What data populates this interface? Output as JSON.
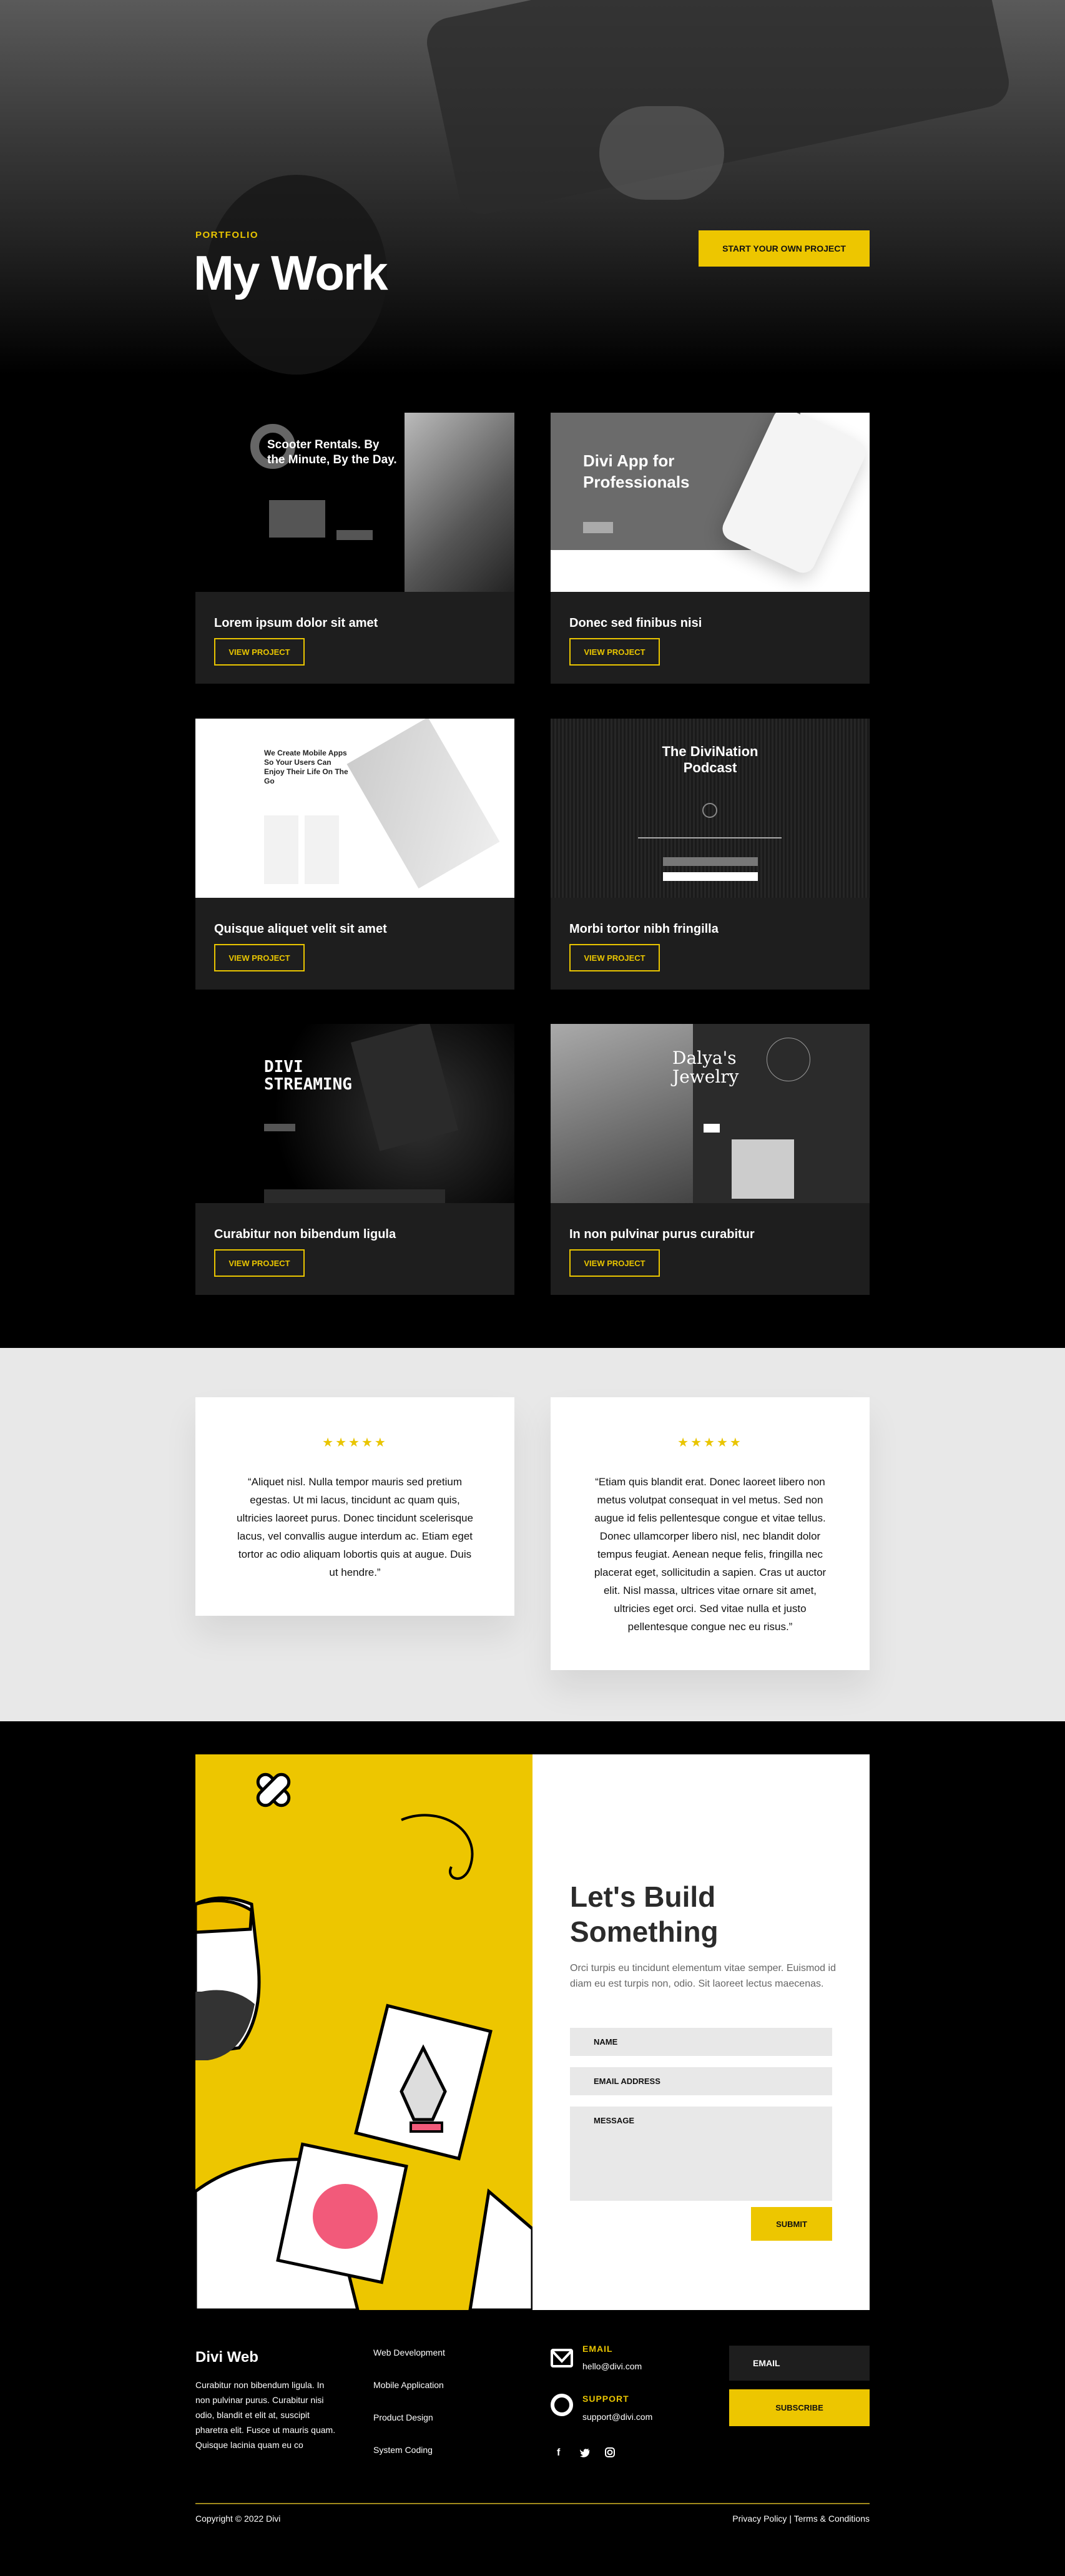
{
  "hero": {
    "eyebrow": "PORTFOLIO",
    "title": "My Work",
    "cta_label": "START YOUR OWN PROJECT"
  },
  "projects": [
    {
      "title": "Lorem ipsum dolor sit amet",
      "button": "VIEW PROJECT",
      "preview_heading": "Scooter Rentals. By the Minute, By the Day."
    },
    {
      "title": "Donec sed finibus nisi",
      "button": "VIEW PROJECT",
      "preview_heading": "Divi App for Professionals"
    },
    {
      "title": "Quisque aliquet velit sit amet",
      "button": "VIEW PROJECT",
      "preview_heading": "We Create Mobile Apps So Your Users Can Enjoy Their Life On The Go"
    },
    {
      "title": "Morbi tortor nibh fringilla",
      "button": "VIEW PROJECT",
      "preview_heading": "The DiviNation Podcast"
    },
    {
      "title": "Curabitur non bibendum ligula",
      "button": "VIEW PROJECT",
      "preview_heading": "DIVI STREAMING"
    },
    {
      "title": "In non pulvinar purus curabitur",
      "button": "VIEW PROJECT",
      "preview_heading": "Dalya's Jewelry"
    }
  ],
  "testimonials": [
    {
      "stars": "★★★★★",
      "rating": 5,
      "quote": "“Aliquet nisl. Nulla tempor mauris sed pretium egestas. Ut mi lacus, tincidunt ac quam quis, ultricies laoreet purus. Donec tincidunt scelerisque lacus, vel convallis augue interdum ac. Etiam eget tortor ac odio aliquam lobortis quis at augue. Duis ut hendre.”"
    },
    {
      "stars": "★★★★★",
      "rating": 5,
      "quote": "“Etiam quis blandit erat. Donec laoreet libero non metus volutpat consequat in vel metus. Sed non augue id felis pellentesque congue et vitae tellus. Donec ullamcorper libero nisl, nec blandit dolor tempus feugiat. Aenean neque felis, fringilla nec placerat eget, sollicitudin a sapien. Cras ut auctor elit. Nisl massa, ultrices vitae ornare sit amet, ultricies eget orci. Sed vitae nulla et justo pellentesque congue nec eu risus.”"
    }
  ],
  "contact": {
    "title": "Let's Build Something",
    "text": "Orci turpis eu tincidunt elementum vitae semper. Euismod id diam eu est turpis non, odio. Sit laoreet lectus maecenas.",
    "name_placeholder": "NAME",
    "email_placeholder": "EMAIL ADDRESS",
    "message_placeholder": "MESSAGE",
    "submit": "SUBMIT"
  },
  "footer": {
    "brand": "Divi Web",
    "about": "Curabitur non bibendum ligula. In non pulvinar purus. Curabitur nisi odio, blandit et elit at, suscipit pharetra elit. Fusce ut mauris quam. Quisque lacinia quam eu co",
    "links": [
      "Web Development",
      "Mobile Application",
      "Product Design",
      "System Coding"
    ],
    "email_label": "EMAIL",
    "email": "hello@divi.com",
    "support_label": "SUPPORT",
    "support": "support@divi.com",
    "social": [
      "facebook-icon",
      "twitter-icon",
      "instagram-icon"
    ],
    "newsletter_placeholder": "EMAIL",
    "subscribe": "SUBSCRIBE",
    "copyright": "Copyright © 2022 Divi",
    "privacy": "Privacy Policy",
    "separator": "|",
    "terms": "Terms & Conditions"
  },
  "colors": {
    "accent": "#edc600",
    "dark_card": "#1e1e1e",
    "light_bg": "#e8e8e8"
  }
}
